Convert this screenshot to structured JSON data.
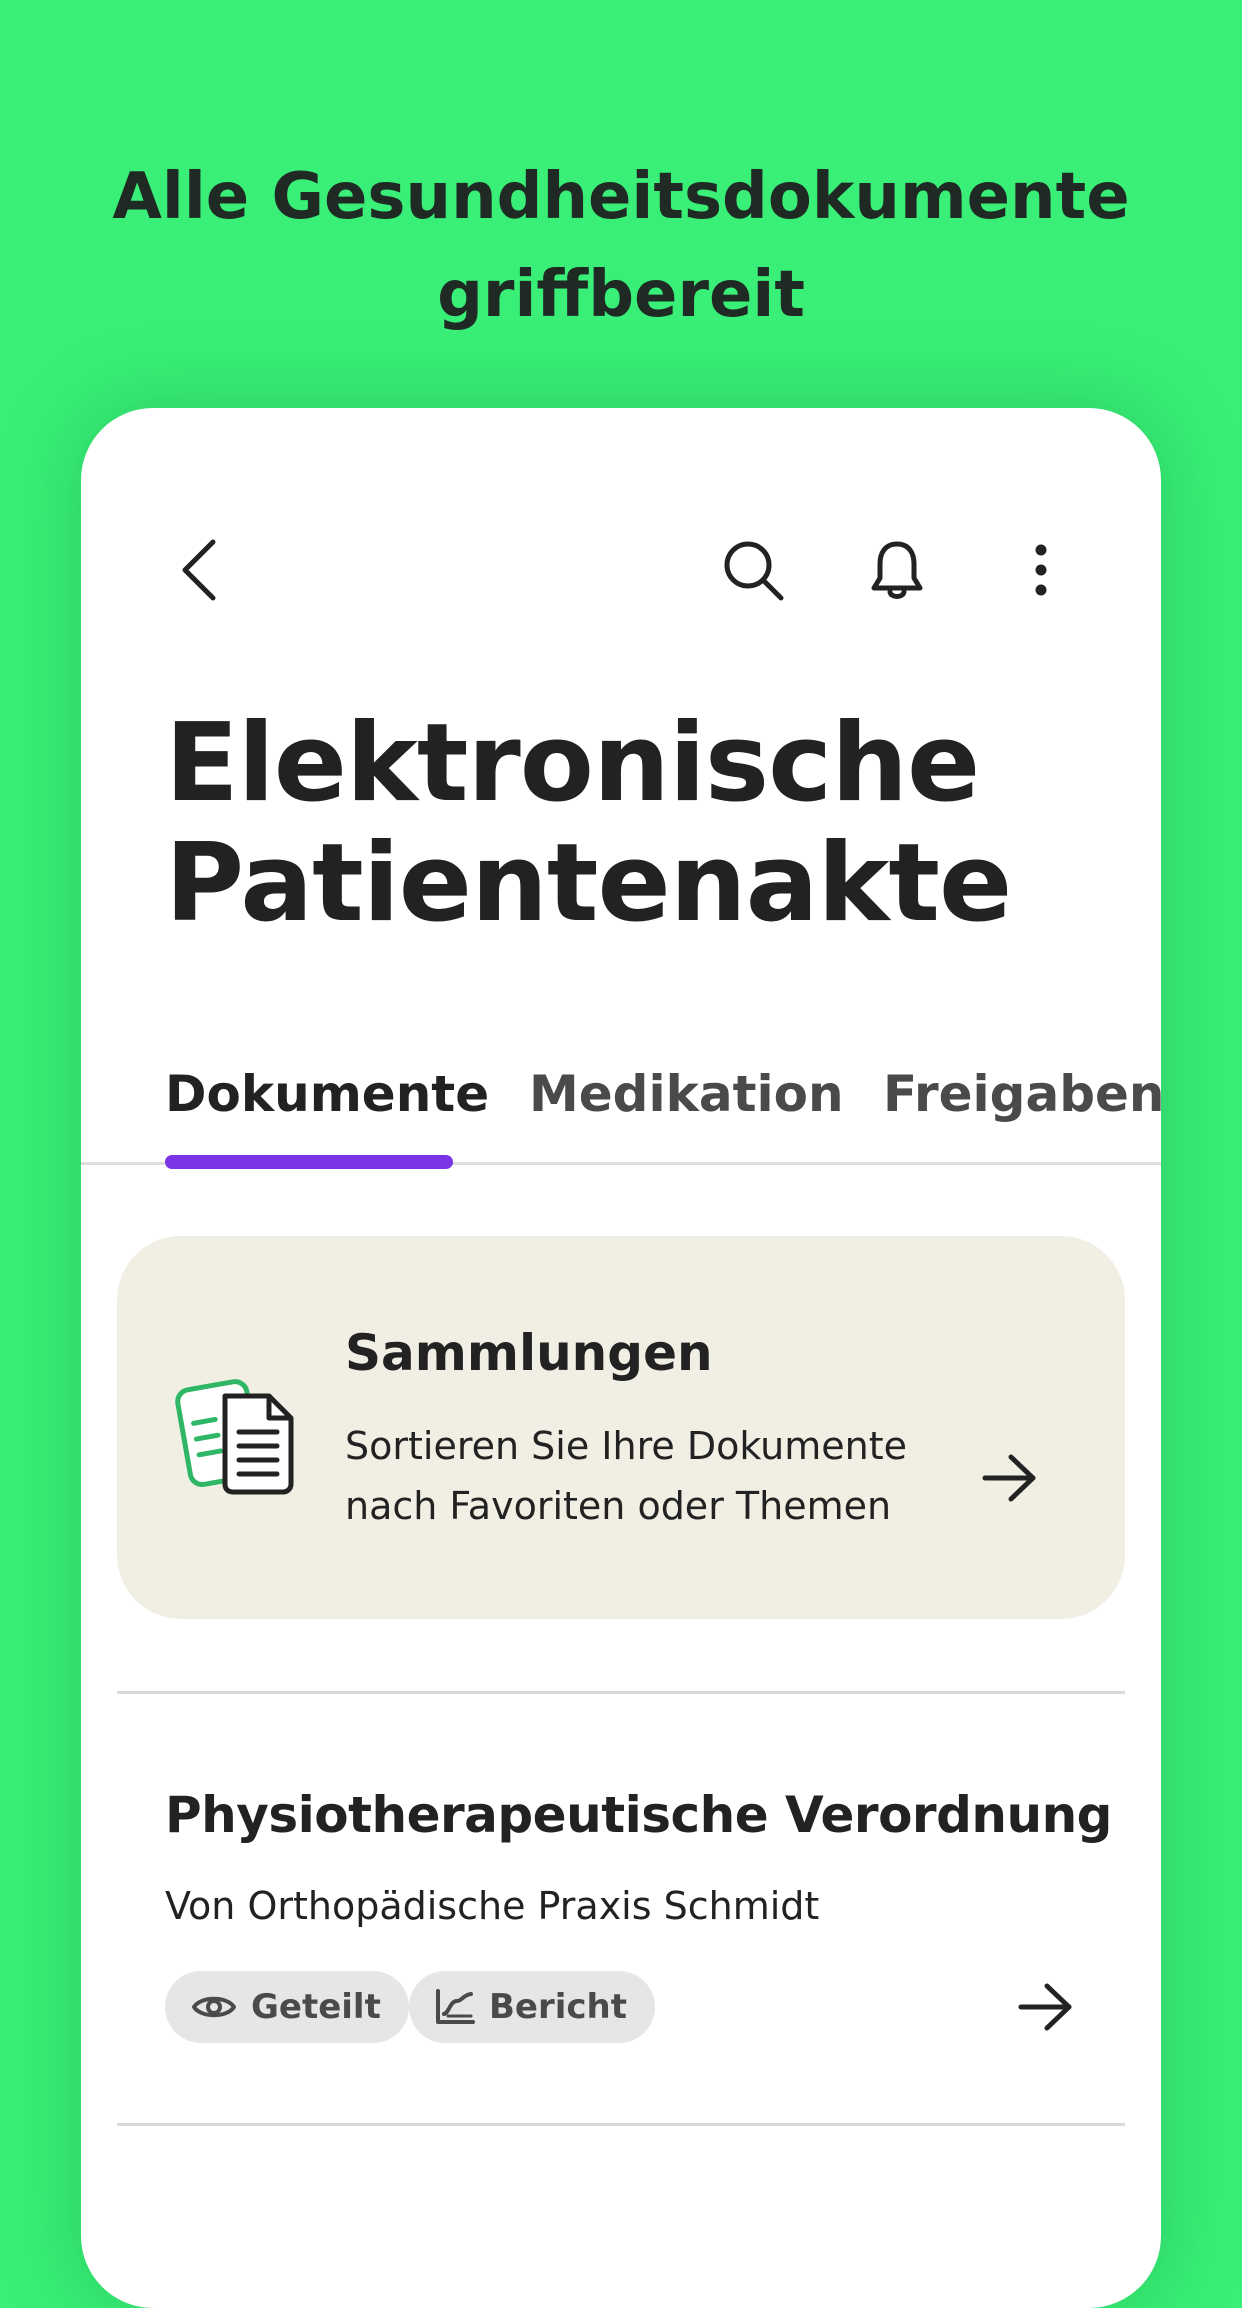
{
  "promo": {
    "headline_line1": "Alle Gesundheitsdokumente",
    "headline_line2": "griffbereit",
    "background_color": "#39ef77"
  },
  "toolbar": {
    "back_icon": "chevron-left-icon",
    "search_icon": "search-icon",
    "notifications_icon": "bell-icon",
    "more_icon": "more-vertical-icon"
  },
  "page": {
    "title_line1": "Elektronische",
    "title_line2": "Patientenakte"
  },
  "tabs": [
    {
      "label": "Dokumente",
      "active": true
    },
    {
      "label": "Medikation",
      "active": false
    },
    {
      "label": "Freigaben",
      "active": false
    }
  ],
  "accent_color": "#7b35e6",
  "collections": {
    "title": "Sammlungen",
    "description": "Sortieren Sie Ihre Dokumente nach Favoriten oder Themen",
    "icon": "documents-icon",
    "arrow_icon": "arrow-right-icon",
    "background_color": "#f1eee3"
  },
  "documents": [
    {
      "title": "Physiotherapeutische Verordnung",
      "source": "Von Orthopädische Praxis Schmidt",
      "tags": [
        {
          "label": "Geteilt",
          "icon": "eye-icon"
        },
        {
          "label": "Bericht",
          "icon": "chart-icon"
        }
      ],
      "arrow_icon": "arrow-right-icon"
    }
  ]
}
